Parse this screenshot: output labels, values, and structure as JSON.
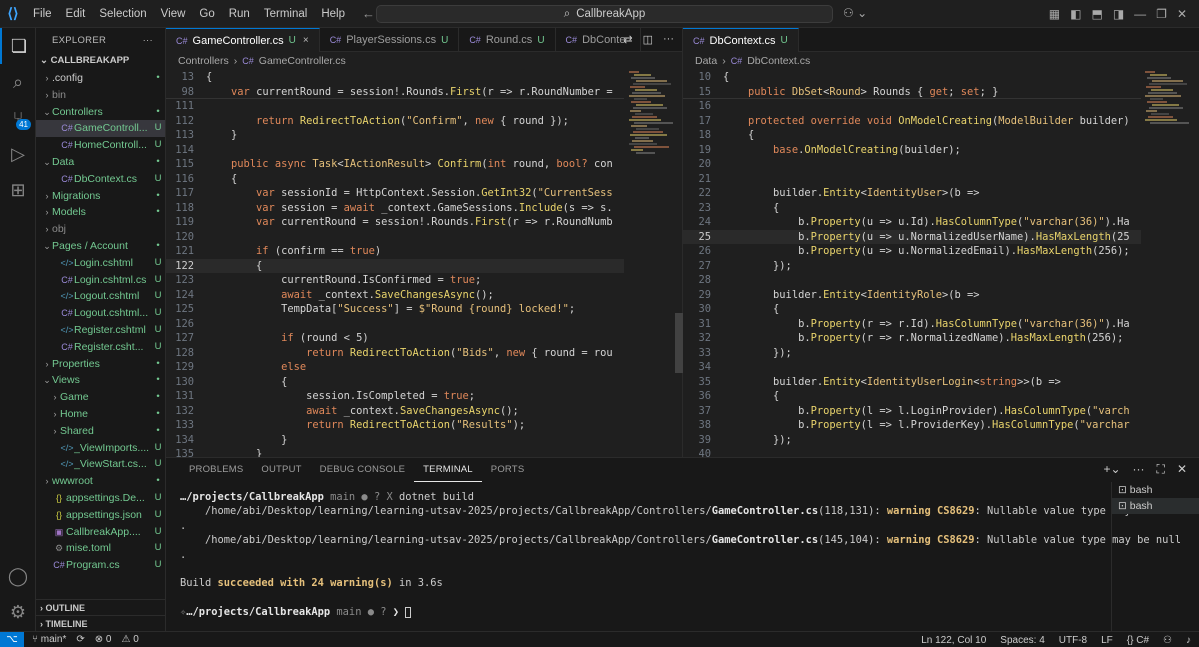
{
  "titlebar": {
    "menu": [
      "File",
      "Edit",
      "Selection",
      "View",
      "Go",
      "Run",
      "Terminal",
      "Help"
    ],
    "search": "CallbreakApp"
  },
  "activity": {
    "scm_badge": "41"
  },
  "explorer": {
    "header": "EXPLORER",
    "more": "···",
    "root": "CALLBREAKAPP",
    "items": [
      {
        "label": ".config",
        "indent": 1,
        "kind": "folder",
        "open": false,
        "status": "•",
        "status_color": "#73c991",
        "color": "#cccccc"
      },
      {
        "label": "bin",
        "indent": 1,
        "kind": "folder",
        "open": false,
        "status": "",
        "status_color": "",
        "color": "#8c8c8c"
      },
      {
        "label": "Controllers",
        "indent": 1,
        "kind": "folder",
        "open": true,
        "status": "•",
        "status_color": "#73c991",
        "color": "#73c991"
      },
      {
        "label": "GameControll...",
        "indent": 2,
        "kind": "cs",
        "status": "U",
        "status_color": "#73c991",
        "color": "#73c991",
        "selected": true
      },
      {
        "label": "HomeControll...",
        "indent": 2,
        "kind": "cs",
        "status": "U",
        "status_color": "#73c991",
        "color": "#73c991"
      },
      {
        "label": "Data",
        "indent": 1,
        "kind": "folder",
        "open": true,
        "status": "•",
        "status_color": "#73c991",
        "color": "#73c991"
      },
      {
        "label": "DbContext.cs",
        "indent": 2,
        "kind": "cs",
        "status": "U",
        "status_color": "#73c991",
        "color": "#73c991"
      },
      {
        "label": "Migrations",
        "indent": 1,
        "kind": "folder",
        "open": false,
        "status": "•",
        "status_color": "#73c991",
        "color": "#73c991"
      },
      {
        "label": "Models",
        "indent": 1,
        "kind": "folder",
        "open": false,
        "status": "•",
        "status_color": "#73c991",
        "color": "#73c991"
      },
      {
        "label": "obj",
        "indent": 1,
        "kind": "folder",
        "open": false,
        "status": "",
        "status_color": "",
        "color": "#8c8c8c"
      },
      {
        "label": "Pages / Account",
        "indent": 1,
        "kind": "folder",
        "open": true,
        "status": "•",
        "status_color": "#73c991",
        "color": "#73c991"
      },
      {
        "label": "Login.cshtml",
        "indent": 2,
        "kind": "cshtml",
        "status": "U",
        "status_color": "#73c991",
        "color": "#73c991"
      },
      {
        "label": "Login.cshtml.cs",
        "indent": 2,
        "kind": "cs",
        "status": "U",
        "status_color": "#73c991",
        "color": "#73c991"
      },
      {
        "label": "Logout.cshtml",
        "indent": 2,
        "kind": "cshtml",
        "status": "U",
        "status_color": "#73c991",
        "color": "#73c991"
      },
      {
        "label": "Logout.cshtml...",
        "indent": 2,
        "kind": "cs",
        "status": "U",
        "status_color": "#73c991",
        "color": "#73c991"
      },
      {
        "label": "Register.cshtml",
        "indent": 2,
        "kind": "cshtml",
        "status": "U",
        "status_color": "#73c991",
        "color": "#73c991"
      },
      {
        "label": "Register.csht...",
        "indent": 2,
        "kind": "cs",
        "status": "U",
        "status_color": "#73c991",
        "color": "#73c991"
      },
      {
        "label": "Properties",
        "indent": 1,
        "kind": "folder",
        "open": false,
        "status": "•",
        "status_color": "#73c991",
        "color": "#73c991"
      },
      {
        "label": "Views",
        "indent": 1,
        "kind": "folder",
        "open": true,
        "status": "•",
        "status_color": "#73c991",
        "color": "#73c991"
      },
      {
        "label": "Game",
        "indent": 2,
        "kind": "folder",
        "open": false,
        "status": "•",
        "status_color": "#73c991",
        "color": "#73c991"
      },
      {
        "label": "Home",
        "indent": 2,
        "kind": "folder",
        "open": false,
        "status": "•",
        "status_color": "#73c991",
        "color": "#73c991"
      },
      {
        "label": "Shared",
        "indent": 2,
        "kind": "folder",
        "open": false,
        "status": "•",
        "status_color": "#73c991",
        "color": "#73c991"
      },
      {
        "label": "_ViewImports....",
        "indent": 2,
        "kind": "cshtml",
        "status": "U",
        "status_color": "#73c991",
        "color": "#73c991"
      },
      {
        "label": "_ViewStart.cs...",
        "indent": 2,
        "kind": "cshtml",
        "status": "U",
        "status_color": "#73c991",
        "color": "#73c991"
      },
      {
        "label": "wwwroot",
        "indent": 1,
        "kind": "folder",
        "open": false,
        "status": "•",
        "status_color": "#73c991",
        "color": "#73c991"
      },
      {
        "label": "appsettings.De...",
        "indent": 1,
        "kind": "json",
        "status": "U",
        "status_color": "#73c991",
        "color": "#73c991"
      },
      {
        "label": "appsettings.json",
        "indent": 1,
        "kind": "json",
        "status": "U",
        "status_color": "#73c991",
        "color": "#73c991"
      },
      {
        "label": "CallbreakApp....",
        "indent": 1,
        "kind": "proj",
        "status": "U",
        "status_color": "#73c991",
        "color": "#73c991"
      },
      {
        "label": "mise.toml",
        "indent": 1,
        "kind": "toml",
        "status": "U",
        "status_color": "#73c991",
        "color": "#73c991"
      },
      {
        "label": "Program.cs",
        "indent": 1,
        "kind": "cs",
        "status": "U",
        "status_color": "#73c991",
        "color": "#73c991"
      }
    ],
    "outline": "OUTLINE",
    "timeline": "TIMELINE"
  },
  "left_group": {
    "tabs": [
      {
        "label": "GameController.cs",
        "status": "U",
        "active": true,
        "close": "×"
      },
      {
        "label": "PlayerSessions.cs",
        "status": "U",
        "active": false
      },
      {
        "label": "Round.cs",
        "status": "U",
        "active": false
      },
      {
        "label": "DbConte",
        "status": "",
        "active": false
      }
    ],
    "crumbs": [
      "Controllers",
      "GameController.cs"
    ],
    "lines": [
      {
        "n": "13",
        "html": "<span class='pl'>{</span>"
      },
      {
        "n": "98",
        "html": "    <span class='kw'>var</span> currentRound = session!.Rounds.<span class='fn'>First</span>(r => r.RoundNumber ="
      },
      {
        "n": "111",
        "html": ""
      },
      {
        "n": "112",
        "html": "        <span class='kw'>return</span> <span class='fn'>RedirectToAction</span>(<span class='str'>\"Confirm\"</span>, <span class='kw'>new</span> { round });"
      },
      {
        "n": "113",
        "html": "    }"
      },
      {
        "n": "114",
        "html": ""
      },
      {
        "n": "115",
        "html": "    <span class='kw'>public async</span> <span class='ty'>Task</span>&lt;<span class='ty'>IActionResult</span>&gt; <span class='fn'>Confirm</span>(<span class='kw'>int</span> round, <span class='kw'>bool?</span> con"
      },
      {
        "n": "116",
        "html": "    {"
      },
      {
        "n": "117",
        "html": "        <span class='kw'>var</span> sessionId = HttpContext.Session.<span class='fn'>GetInt32</span>(<span class='str'>\"CurrentSess</span>"
      },
      {
        "n": "118",
        "html": "        <span class='kw'>var</span> session = <span class='kw'>await</span> _context.GameSessions.<span class='fn'>Include</span>(s => s."
      },
      {
        "n": "119",
        "html": "        <span class='kw'>var</span> currentRound = session!.Rounds.<span class='fn'>First</span>(r => r.RoundNumb"
      },
      {
        "n": "120",
        "html": ""
      },
      {
        "n": "121",
        "html": "        <span class='kw'>if</span> (confirm == <span class='kw'>true</span>)"
      },
      {
        "n": "122",
        "html": "        {",
        "cur": true
      },
      {
        "n": "123",
        "html": "            currentRound.IsConfirmed = <span class='kw'>true</span>;"
      },
      {
        "n": "124",
        "html": "            <span class='kw'>await</span> _context.<span class='fn'>SaveChangesAsync</span>();"
      },
      {
        "n": "125",
        "html": "            TempData[<span class='str'>\"Success\"</span>] = <span class='str'>$\"Round {round} locked!\"</span>;"
      },
      {
        "n": "126",
        "html": ""
      },
      {
        "n": "127",
        "html": "            <span class='kw'>if</span> (round &lt; 5)"
      },
      {
        "n": "128",
        "html": "                <span class='kw'>return</span> <span class='fn'>RedirectToAction</span>(<span class='str'>\"Bids\"</span>, <span class='kw'>new</span> { round = rou"
      },
      {
        "n": "129",
        "html": "            <span class='kw'>else</span>"
      },
      {
        "n": "130",
        "html": "            {"
      },
      {
        "n": "131",
        "html": "                session.IsCompleted = <span class='kw'>true</span>;"
      },
      {
        "n": "132",
        "html": "                <span class='kw'>await</span> _context.<span class='fn'>SaveChangesAsync</span>();"
      },
      {
        "n": "133",
        "html": "                <span class='kw'>return</span> <span class='fn'>RedirectToAction</span>(<span class='str'>\"Results\"</span>);"
      },
      {
        "n": "134",
        "html": "            }"
      },
      {
        "n": "135",
        "html": "        }"
      }
    ]
  },
  "right_group": {
    "tabs": [
      {
        "label": "DbContext.cs",
        "status": "U",
        "active": true
      }
    ],
    "crumbs": [
      "Data",
      "DbContext.cs"
    ],
    "lines": [
      {
        "n": "10",
        "html": "<span class='pl'>{</span>"
      },
      {
        "n": "15",
        "html": "    <span class='kw'>public</span> <span class='ty'>DbSet</span>&lt;<span class='ty'>Round</span>&gt; Rounds { <span class='kw'>get</span>; <span class='kw'>set</span>; }"
      },
      {
        "n": "16",
        "html": ""
      },
      {
        "n": "17",
        "html": "    <span class='kw'>protected override void</span> <span class='fn'>OnModelCreating</span>(<span class='ty'>ModelBuilder</span> builder)"
      },
      {
        "n": "18",
        "html": "    {"
      },
      {
        "n": "19",
        "html": "        <span class='kw'>base</span>.<span class='fn'>OnModelCreating</span>(builder);"
      },
      {
        "n": "20",
        "html": ""
      },
      {
        "n": "21",
        "html": ""
      },
      {
        "n": "22",
        "html": "        builder.<span class='fn'>Entity</span>&lt;<span class='ty'>IdentityUser</span>&gt;(b =>"
      },
      {
        "n": "23",
        "html": "        {"
      },
      {
        "n": "24",
        "html": "            b.<span class='fn'>Property</span>(u => u.Id).<span class='fn'>HasColumnType</span>(<span class='str'>\"varchar(36)\"</span>).Ha"
      },
      {
        "n": "25",
        "html": "            b.<span class='fn'>Property</span>(u => u.NormalizedUserName).<span class='fn'>HasMaxLength</span>(25",
        "cur": true
      },
      {
        "n": "26",
        "html": "            b.<span class='fn'>Property</span>(u => u.NormalizedEmail).<span class='fn'>HasMaxLength</span>(256);"
      },
      {
        "n": "27",
        "html": "        });"
      },
      {
        "n": "28",
        "html": ""
      },
      {
        "n": "29",
        "html": "        builder.<span class='fn'>Entity</span>&lt;<span class='ty'>IdentityRole</span>&gt;(b =>"
      },
      {
        "n": "30",
        "html": "        {"
      },
      {
        "n": "31",
        "html": "            b.<span class='fn'>Property</span>(r => r.Id).<span class='fn'>HasColumnType</span>(<span class='str'>\"varchar(36)\"</span>).Ha"
      },
      {
        "n": "32",
        "html": "            b.<span class='fn'>Property</span>(r => r.NormalizedName).<span class='fn'>HasMaxLength</span>(256);"
      },
      {
        "n": "33",
        "html": "        });"
      },
      {
        "n": "34",
        "html": ""
      },
      {
        "n": "35",
        "html": "        builder.<span class='fn'>Entity</span>&lt;<span class='ty'>IdentityUserLogin</span>&lt;<span class='kw'>string</span>&gt;&gt;(b =>"
      },
      {
        "n": "36",
        "html": "        {"
      },
      {
        "n": "37",
        "html": "            b.<span class='fn'>Property</span>(l => l.LoginProvider).<span class='fn'>HasColumnType</span>(<span class='str'>\"varch</span>"
      },
      {
        "n": "38",
        "html": "            b.<span class='fn'>Property</span>(l => l.ProviderKey).<span class='fn'>HasColumnType</span>(<span class='str'>\"varchar</span>"
      },
      {
        "n": "39",
        "html": "        });"
      },
      {
        "n": "40",
        "html": ""
      }
    ]
  },
  "panel": {
    "tabs": [
      "PROBLEMS",
      "OUTPUT",
      "DEBUG CONSOLE",
      "TERMINAL",
      "PORTS"
    ],
    "active_tab": "TERMINAL",
    "terminal_lines": [
      "<span class='tb'>…/projects/CallbreakApp</span> <span class='tgray'>main ● ? X</span> dotnet build",
      "    /home/abi/Desktop/learning/learning-utsav-2025/projects/CallbreakApp/Controllers/<span class='tb'>GameController.cs</span>(118,131): <span class='tyel'>warning CS8629</span>: Nullable value type may be null",
      ".",
      "    /home/abi/Desktop/learning/learning-utsav-2025/projects/CallbreakApp/Controllers/<span class='tb'>GameController.cs</span>(145,104): <span class='tyel'>warning CS8629</span>: Nullable value type may be null",
      ".",
      "",
      "Build <span class='tgreen'>succeeded with 24 warning(s)</span> in 3.6s",
      "",
      "<span class='tgray'>✧</span><span class='tb'>…/projects/CallbreakApp</span> <span class='tgray'>main ● ? </span><span class='tb'>❯</span> <span style='border:1px solid #ccc;display:inline-block;width:6px;height:11px;vertical-align:middle'></span>"
    ],
    "shells": [
      "bash",
      "bash"
    ]
  },
  "status": {
    "branch": "main*",
    "sync": "⟳",
    "errors": "⊗ 0",
    "warnings": "⚠ 0",
    "position": "Ln 122, Col 10",
    "spaces": "Spaces: 4",
    "encoding": "UTF-8",
    "eol": "LF",
    "lang": "{} C#"
  }
}
